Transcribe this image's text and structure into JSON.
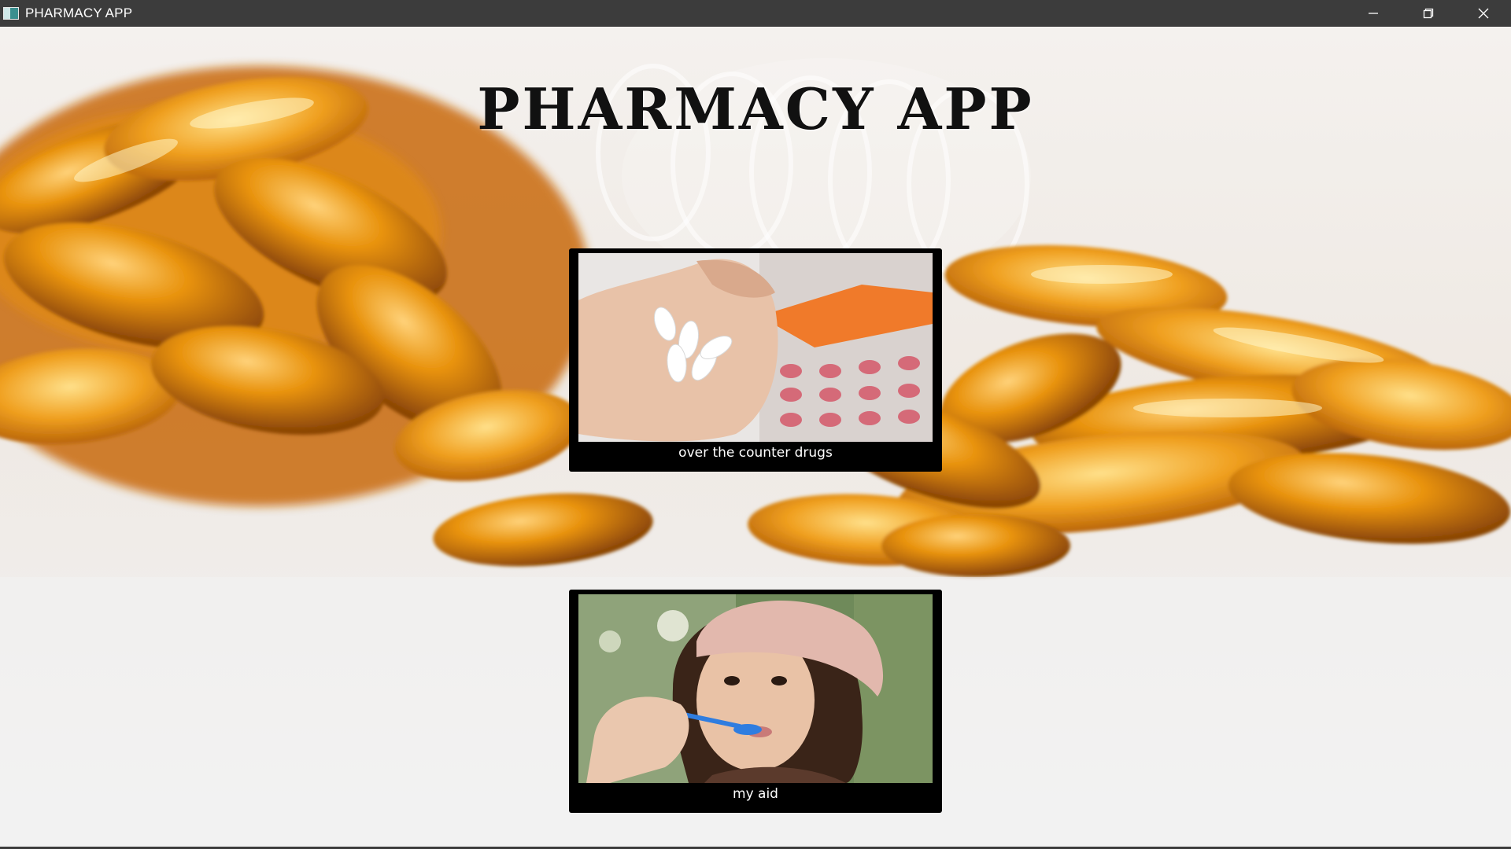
{
  "window": {
    "title": "PHARMACY APP",
    "controls": {
      "minimize": "minimize-icon",
      "maximize": "restore-icon",
      "close": "close-icon"
    }
  },
  "main": {
    "heading": "PHARMACY APP",
    "cards": [
      {
        "label": "over the counter drugs",
        "image": "hand-holding-pills-image"
      },
      {
        "label": "my aid",
        "image": "woman-taking-medicine-image"
      }
    ]
  },
  "colors": {
    "titlebar": "#3c3c3c",
    "card": "#000000",
    "amber": "#e8920c"
  }
}
